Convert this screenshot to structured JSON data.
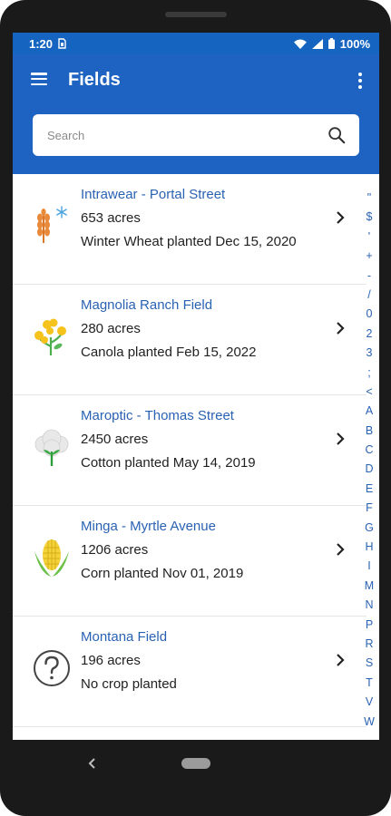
{
  "status": {
    "time": "1:20",
    "sim_icon": "sim-card-icon",
    "battery": "100%"
  },
  "appbar": {
    "title": "Fields",
    "menu_icon": "hamburger-menu-icon",
    "more_icon": "more-vertical-icon"
  },
  "search": {
    "placeholder": "Search",
    "value": ""
  },
  "fields": [
    {
      "name": "Intrawear - Portal Street",
      "acres": "653 acres",
      "planted": "Winter Wheat planted Dec 15, 2020",
      "icon": "winter-wheat-icon"
    },
    {
      "name": "Magnolia Ranch Field",
      "acres": "280 acres",
      "planted": "Canola planted Feb 15, 2022",
      "icon": "canola-icon"
    },
    {
      "name": "Maroptic - Thomas Street",
      "acres": "2450 acres",
      "planted": "Cotton planted May 14, 2019",
      "icon": "cotton-icon"
    },
    {
      "name": "Minga - Myrtle Avenue",
      "acres": "1206 acres",
      "planted": "Corn planted Nov 01, 2019",
      "icon": "corn-icon"
    },
    {
      "name": "Montana Field",
      "acres": "196 acres",
      "planted": "No crop planted",
      "icon": "unknown-crop-icon"
    }
  ],
  "index_letters": [
    "\"",
    "$",
    "'",
    "+",
    "-",
    "/",
    "0",
    "2",
    "3",
    ";",
    "<",
    "A",
    "B",
    "C",
    "D",
    "E",
    "F",
    "G",
    "H",
    "I",
    "M",
    "N",
    "P",
    "R",
    "S",
    "T",
    "V",
    "W"
  ],
  "colors": {
    "primary": "#1e63c2",
    "statusbar": "#1565c0",
    "link": "#2a62b3"
  }
}
